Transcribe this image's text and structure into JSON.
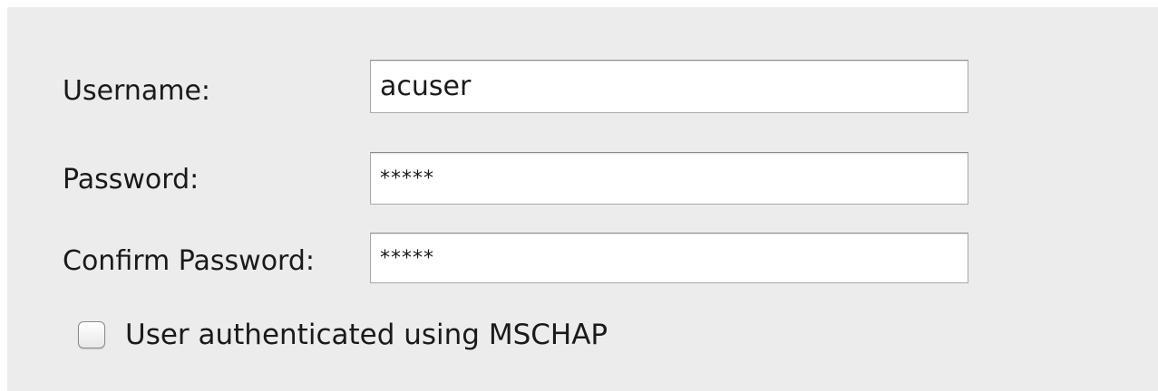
{
  "form": {
    "username": {
      "label": "Username:",
      "value": "acuser"
    },
    "password": {
      "label": "Password:",
      "value": "*****"
    },
    "confirm_password": {
      "label": "Confirm Password:",
      "value": "*****"
    },
    "mschap": {
      "label": "User authenticated using MSCHAP",
      "checked": false
    }
  }
}
